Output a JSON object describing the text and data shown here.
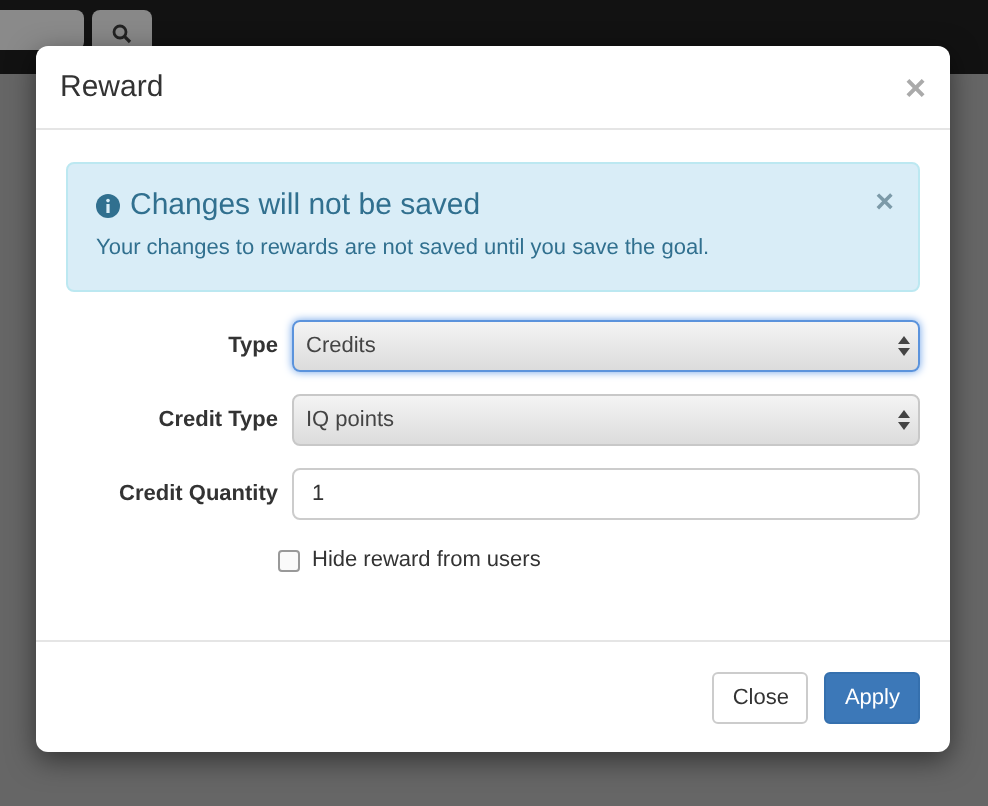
{
  "modal": {
    "title": "Reward",
    "close": "×"
  },
  "alert": {
    "title": "Changes will not be saved",
    "message": "Your changes to rewards are not saved until you save the goal.",
    "close": "×"
  },
  "fields": [
    {
      "kind": "select",
      "label": "Type",
      "value": "Credits",
      "focused": true
    },
    {
      "kind": "select",
      "label": "Credit Type",
      "value": "IQ points",
      "focused": false
    },
    {
      "kind": "input",
      "label": "Credit Quantity",
      "value": "1",
      "focused": false
    }
  ],
  "checkbox": {
    "label": "Hide reward from users",
    "checked": false
  },
  "buttons": [
    {
      "label": "Close",
      "kind": "default"
    },
    {
      "label": "Apply",
      "kind": "primary"
    }
  ]
}
